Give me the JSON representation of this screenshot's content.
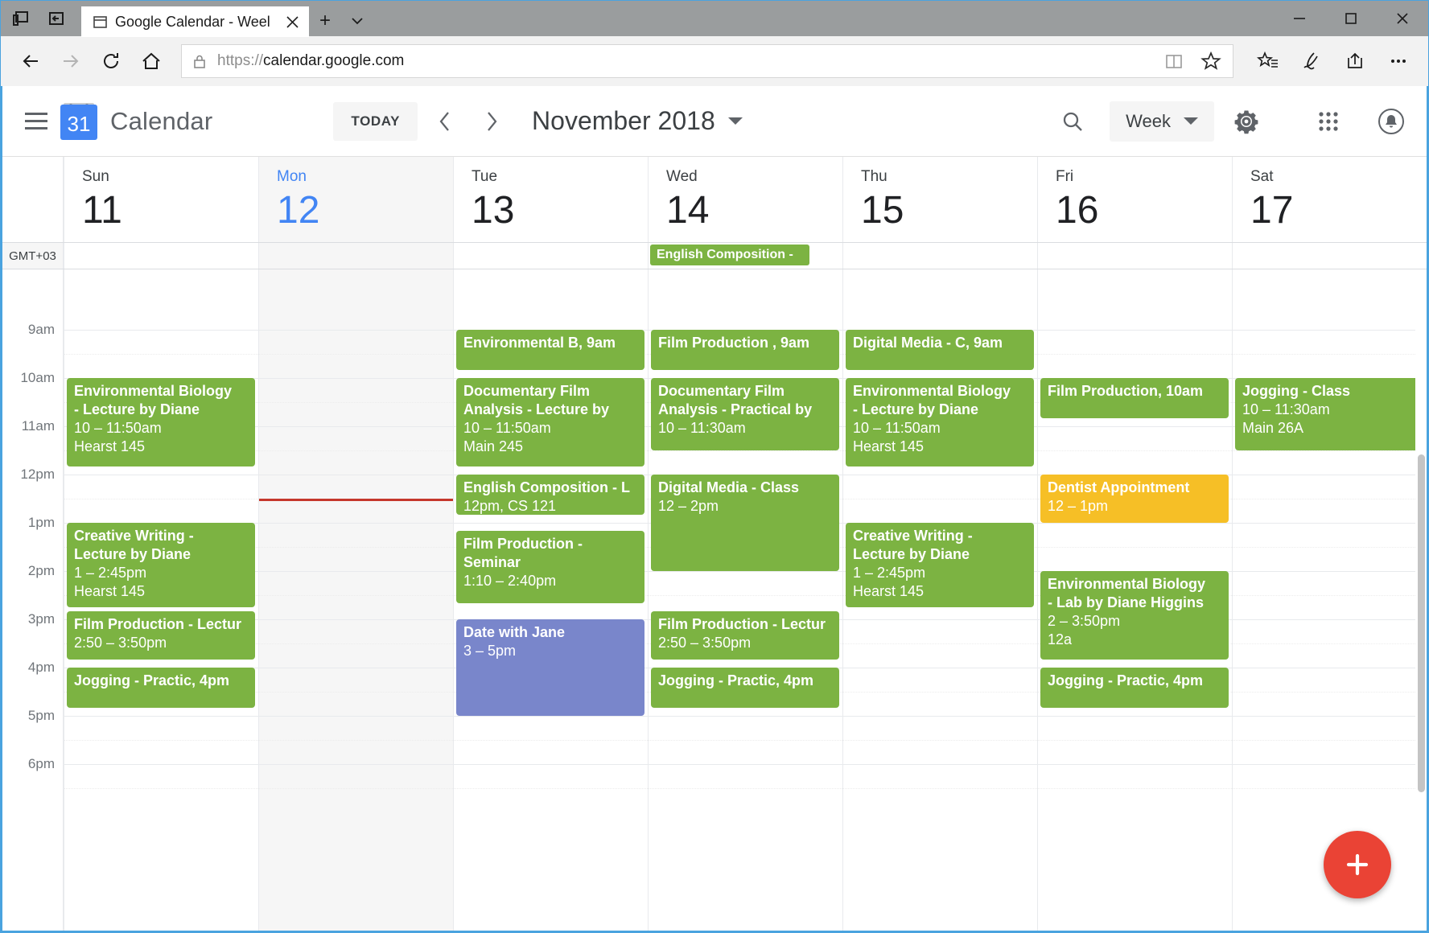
{
  "browser": {
    "tab": {
      "title": "Google Calendar - Weel",
      "favicon_icon": "window-icon",
      "close_icon": "close-icon"
    },
    "newtab_label": "+",
    "tabmenu_icon": "chevron-down-icon",
    "tabs_left_icons": [
      "tab-preview-icon",
      "set-aside-tabs-icon"
    ],
    "window_controls": {
      "minimize": "minimize-icon",
      "maximize": "maximize-icon",
      "close": "close-icon"
    },
    "nav": {
      "back_icon": "back-arrow-icon",
      "forward_icon": "forward-arrow-icon",
      "refresh_icon": "refresh-icon",
      "home_icon": "home-icon"
    },
    "address": {
      "lock_icon": "lock-icon",
      "scheme": "https://",
      "host": "calendar.google.com",
      "reading_view_icon": "book-icon",
      "favorite_icon": "star-icon"
    },
    "toolbar_right": [
      {
        "name": "favorites-hub-icon",
        "glyph": "star-list-icon"
      },
      {
        "name": "web-notes-icon",
        "glyph": "pen-icon"
      },
      {
        "name": "share-icon",
        "glyph": "share-icon"
      },
      {
        "name": "more-icon",
        "glyph": "ellipsis-icon"
      }
    ]
  },
  "app": {
    "menu_icon": "hamburger-menu-icon",
    "logo": {
      "name": "google-calendar-logo",
      "day_number": "31"
    },
    "brand": "Calendar",
    "today_button": "TODAY",
    "prev_icon": "chevron-left-icon",
    "next_icon": "chevron-right-icon",
    "period_label": "November 2018",
    "period_caret_icon": "caret-down-icon",
    "search_icon": "search-icon",
    "view_selector": {
      "label": "Week",
      "caret_icon": "caret-down-icon"
    },
    "settings_icon": "gear-icon",
    "apps_icon": "apps-grid-icon",
    "notifications_icon": "bell-icon",
    "create_button": {
      "name": "create-event-fab",
      "icon": "plus-icon"
    }
  },
  "calendar": {
    "timezone_label": "GMT+03",
    "time_labels": [
      "9am",
      "10am",
      "11am",
      "12pm",
      "1pm",
      "2pm",
      "3pm",
      "4pm",
      "5pm",
      "6pm"
    ],
    "now_indicator": {
      "day_index": 1,
      "time": "12:30pm"
    },
    "days": [
      {
        "name": "Sun",
        "number": "11",
        "today": false
      },
      {
        "name": "Mon",
        "number": "12",
        "today": true
      },
      {
        "name": "Tue",
        "number": "13",
        "today": false
      },
      {
        "name": "Wed",
        "number": "14",
        "today": false
      },
      {
        "name": "Thu",
        "number": "15",
        "today": false
      },
      {
        "name": "Fri",
        "number": "16",
        "today": false
      },
      {
        "name": "Sat",
        "number": "17",
        "today": false
      }
    ],
    "allday_events": [
      {
        "day_index": 3,
        "title": "English Composition -",
        "color": "#7cb342"
      }
    ],
    "colors": {
      "green": "#7cb342",
      "orange": "#f6bf26",
      "purple": "#7986cb",
      "now_line": "#c5372c",
      "accent_blue": "#4285f4"
    },
    "events": [
      {
        "day_index": 0,
        "start": "10:00",
        "end": "11:50",
        "color": "#7cb342",
        "compact": false,
        "lines": [
          "Environmental Biology",
          "- Lecture by Diane",
          "10 – 11:50am",
          "Hearst 145"
        ]
      },
      {
        "day_index": 0,
        "start": "13:00",
        "end": "14:45",
        "color": "#7cb342",
        "compact": false,
        "lines": [
          "Creative Writing -",
          "Lecture by Diane",
          "1 – 2:45pm",
          "Hearst 145"
        ]
      },
      {
        "day_index": 0,
        "start": "14:50",
        "end": "15:50",
        "color": "#7cb342",
        "compact": false,
        "lines": [
          "Film Production - Lectur",
          "2:50 – 3:50pm"
        ]
      },
      {
        "day_index": 0,
        "start": "16:00",
        "end": "16:50",
        "color": "#7cb342",
        "compact": true,
        "lines": [
          "Jogging - Practic, 4pm"
        ]
      },
      {
        "day_index": 2,
        "start": "09:00",
        "end": "09:50",
        "color": "#7cb342",
        "compact": true,
        "lines": [
          "Environmental B, 9am"
        ]
      },
      {
        "day_index": 2,
        "start": "10:00",
        "end": "11:50",
        "color": "#7cb342",
        "compact": false,
        "lines": [
          "Documentary Film",
          "Analysis - Lecture by",
          "10 – 11:50am",
          "Main 245"
        ]
      },
      {
        "day_index": 2,
        "start": "12:00",
        "end": "12:50",
        "color": "#7cb342",
        "compact": false,
        "lines": [
          "English Composition - L",
          "12pm, CS 121"
        ]
      },
      {
        "day_index": 2,
        "start": "13:10",
        "end": "14:40",
        "color": "#7cb342",
        "compact": false,
        "lines": [
          "Film Production -",
          "Seminar",
          "1:10 – 2:40pm"
        ]
      },
      {
        "day_index": 2,
        "start": "15:00",
        "end": "17:00",
        "color": "#7986cb",
        "compact": false,
        "lines": [
          "Date with Jane",
          "3 – 5pm"
        ]
      },
      {
        "day_index": 3,
        "start": "09:00",
        "end": "09:50",
        "color": "#7cb342",
        "compact": true,
        "lines": [
          "Film Production , 9am"
        ]
      },
      {
        "day_index": 3,
        "start": "10:00",
        "end": "11:30",
        "color": "#7cb342",
        "compact": false,
        "lines": [
          "Documentary Film",
          "Analysis - Practical by",
          "10 – 11:30am"
        ]
      },
      {
        "day_index": 3,
        "start": "12:00",
        "end": "14:00",
        "color": "#7cb342",
        "compact": false,
        "lines": [
          "Digital Media - Class",
          "12 – 2pm"
        ]
      },
      {
        "day_index": 3,
        "start": "14:50",
        "end": "15:50",
        "color": "#7cb342",
        "compact": false,
        "lines": [
          "Film Production - Lectur",
          "2:50 – 3:50pm"
        ]
      },
      {
        "day_index": 3,
        "start": "16:00",
        "end": "16:50",
        "color": "#7cb342",
        "compact": true,
        "lines": [
          "Jogging - Practic, 4pm"
        ]
      },
      {
        "day_index": 4,
        "start": "09:00",
        "end": "09:50",
        "color": "#7cb342",
        "compact": true,
        "lines": [
          "Digital Media - C, 9am"
        ]
      },
      {
        "day_index": 4,
        "start": "10:00",
        "end": "11:50",
        "color": "#7cb342",
        "compact": false,
        "lines": [
          "Environmental Biology",
          "- Lecture by Diane",
          "10 – 11:50am",
          "Hearst 145"
        ]
      },
      {
        "day_index": 4,
        "start": "13:00",
        "end": "14:45",
        "color": "#7cb342",
        "compact": false,
        "lines": [
          "Creative Writing -",
          "Lecture by Diane",
          "1 – 2:45pm",
          "Hearst 145"
        ]
      },
      {
        "day_index": 5,
        "start": "10:00",
        "end": "10:50",
        "color": "#7cb342",
        "compact": true,
        "lines": [
          "Film Production, 10am"
        ]
      },
      {
        "day_index": 5,
        "start": "12:00",
        "end": "13:00",
        "color": "#f6bf26",
        "compact": false,
        "lines": [
          "Dentist Appointment",
          "12 – 1pm"
        ]
      },
      {
        "day_index": 5,
        "start": "14:00",
        "end": "15:50",
        "color": "#7cb342",
        "compact": false,
        "lines": [
          "Environmental Biology",
          "- Lab by Diane Higgins",
          "2 – 3:50pm",
          "12a"
        ]
      },
      {
        "day_index": 5,
        "start": "16:00",
        "end": "16:50",
        "color": "#7cb342",
        "compact": true,
        "lines": [
          "Jogging - Practic, 4pm"
        ]
      },
      {
        "day_index": 6,
        "start": "10:00",
        "end": "11:30",
        "color": "#7cb342",
        "compact": false,
        "lines": [
          "Jogging - Class",
          "10 – 11:30am",
          "Main 26A"
        ]
      }
    ]
  }
}
